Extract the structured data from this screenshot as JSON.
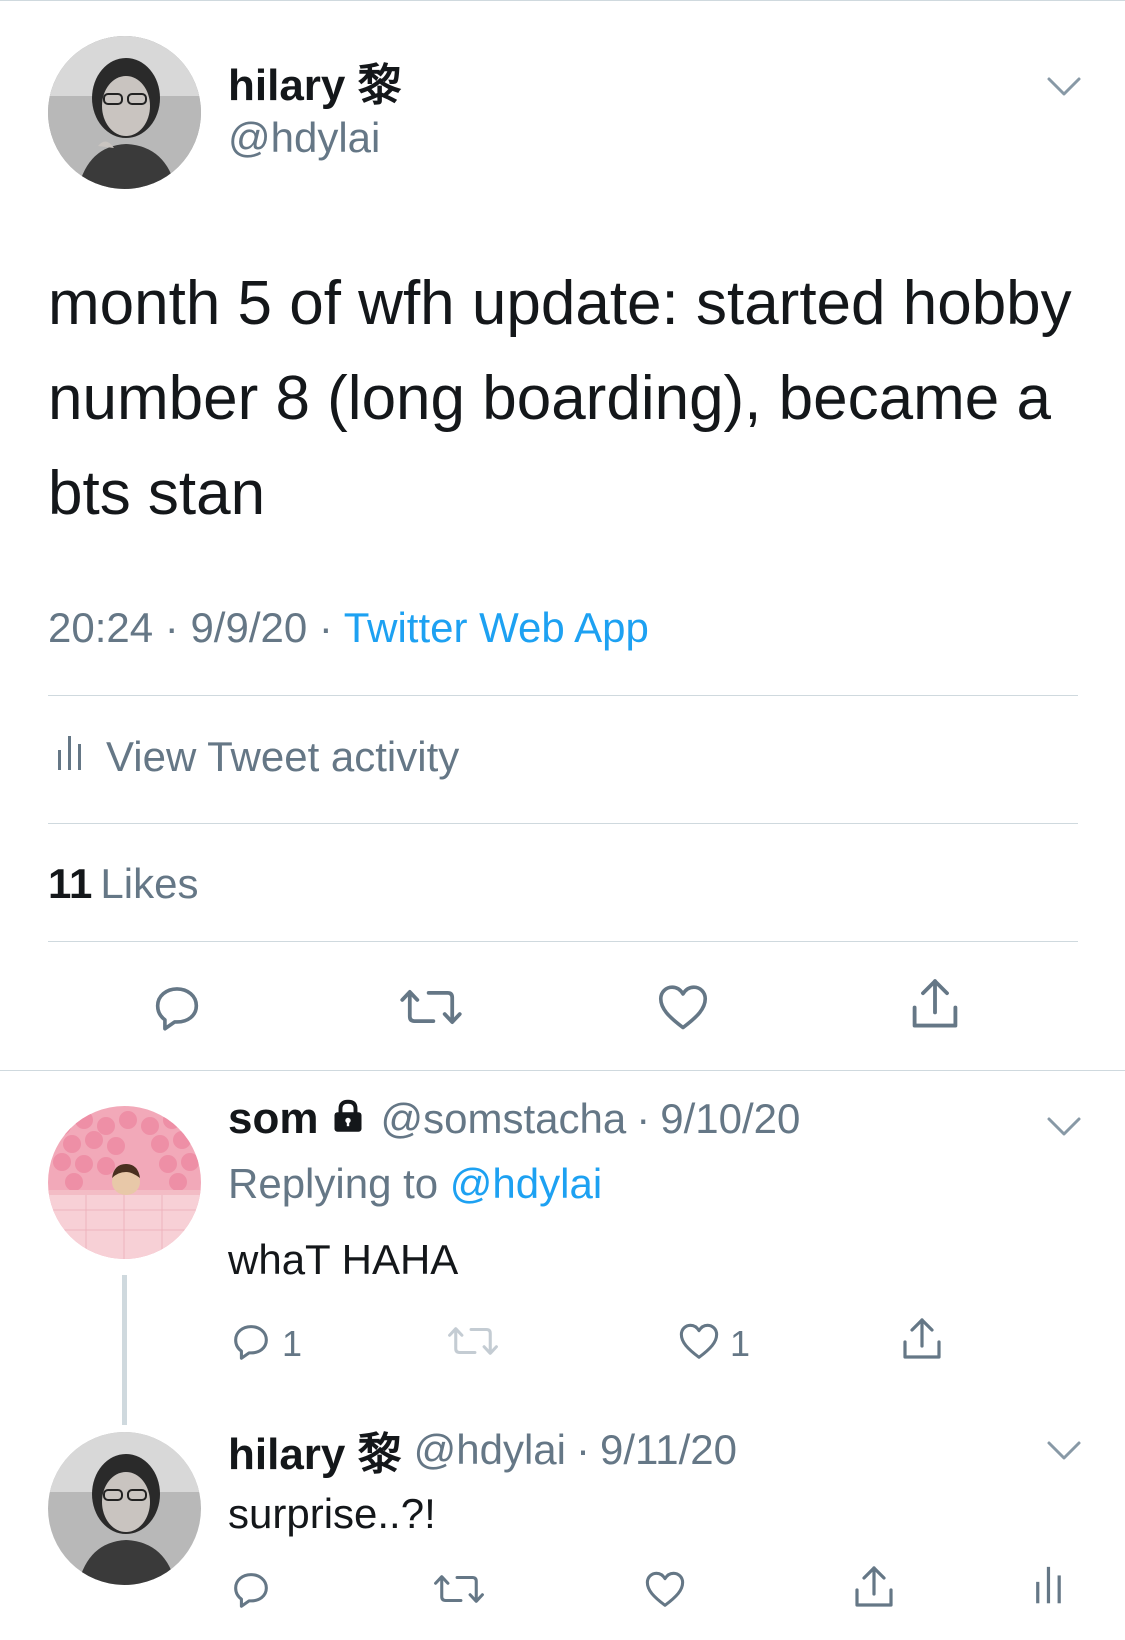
{
  "colors": {
    "primary_text": "#14171a",
    "secondary_text": "#657786",
    "link": "#1da1f2",
    "divider": "#cfd9de"
  },
  "main_tweet": {
    "display_name": "hilary 黎",
    "handle": "@hdylai",
    "text": "month 5 of wfh update: started hobby number 8 (long boarding), became a bts stan",
    "time": "20:24",
    "date": "9/9/20",
    "source": "Twitter Web App",
    "activity_label": "View Tweet activity",
    "likes_count": "11",
    "likes_label": "Likes",
    "actions": [
      "reply-icon",
      "retweet-icon",
      "like-icon",
      "share-icon"
    ]
  },
  "replies": [
    {
      "display_name": "som",
      "protected": true,
      "handle": "@somstacha",
      "date": "9/10/20",
      "replying_prefix": "Replying to",
      "replying_to": "@hdylai",
      "text": "whaT HAHA",
      "reply_count": "1",
      "retweet_count": "",
      "like_count": "1"
    },
    {
      "display_name": "hilary 黎",
      "protected": false,
      "handle": "@hdylai",
      "date": "9/11/20",
      "text": "surprise..?!",
      "reply_count": "",
      "retweet_count": "",
      "like_count": ""
    }
  ]
}
